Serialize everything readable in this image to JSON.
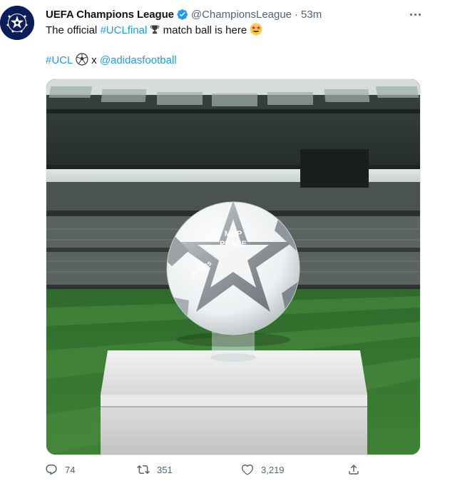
{
  "tweet": {
    "author_name": "UEFA Champions League",
    "handle": "@ChampionsLeague",
    "separator": "·",
    "time": "53m",
    "line1_prefix": "The official ",
    "hashtag_final": "#UCLfinal",
    "line1_middle": " match ball is here",
    "line2_hashtag": "#UCL",
    "line2_x": " x ",
    "line2_mention": "@adidasfootball"
  },
  "media": {
    "ball_text_1": "МИР",
    "ball_text_2": "PEACE",
    "brand": "adidas"
  },
  "actions": {
    "replies": "74",
    "retweets": "351",
    "likes": "3,219"
  },
  "colors": {
    "link": "#1d9bf0",
    "verified": "#1d9bf0",
    "avatar": "#0b1d5a",
    "grey_icon": "#536471"
  },
  "icons": {
    "avatar": "ucl-logo-icon",
    "verified": "verified-badge-icon",
    "more": "more-icon",
    "trophy": "trophy-emoji-icon",
    "star_eyes": "star-struck-emoji-icon",
    "ball": "soccer-ball-emoji-icon",
    "reply": "reply-icon",
    "retweet": "retweet-icon",
    "like": "like-icon",
    "share": "share-icon"
  }
}
